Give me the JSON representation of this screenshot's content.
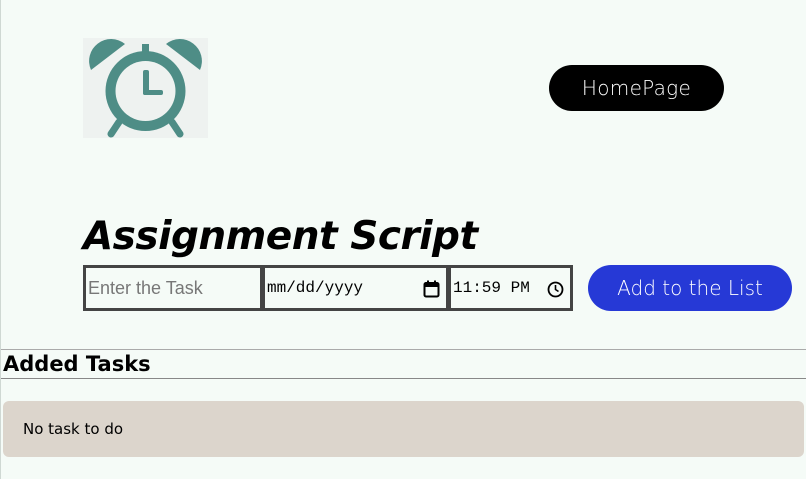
{
  "header": {
    "logo_icon": "alarm-clock-icon",
    "home_button_label": "HomePage"
  },
  "form": {
    "title": "Assignment Script",
    "task_placeholder": "Enter the Task",
    "date_value": "mm/dd/yyyy",
    "date_icon": "calendar-icon",
    "time_value": "11:59 PM",
    "time_icon": "clock-icon",
    "add_button_label": "Add to the List"
  },
  "tasks": {
    "heading": "Added Tasks",
    "empty_message": "No task to do"
  },
  "colors": {
    "background": "#f5fbf7",
    "logo_teal": "#4e8d86",
    "home_button": "#000000",
    "add_button": "#2639d6",
    "empty_panel": "#dcd5cc"
  }
}
